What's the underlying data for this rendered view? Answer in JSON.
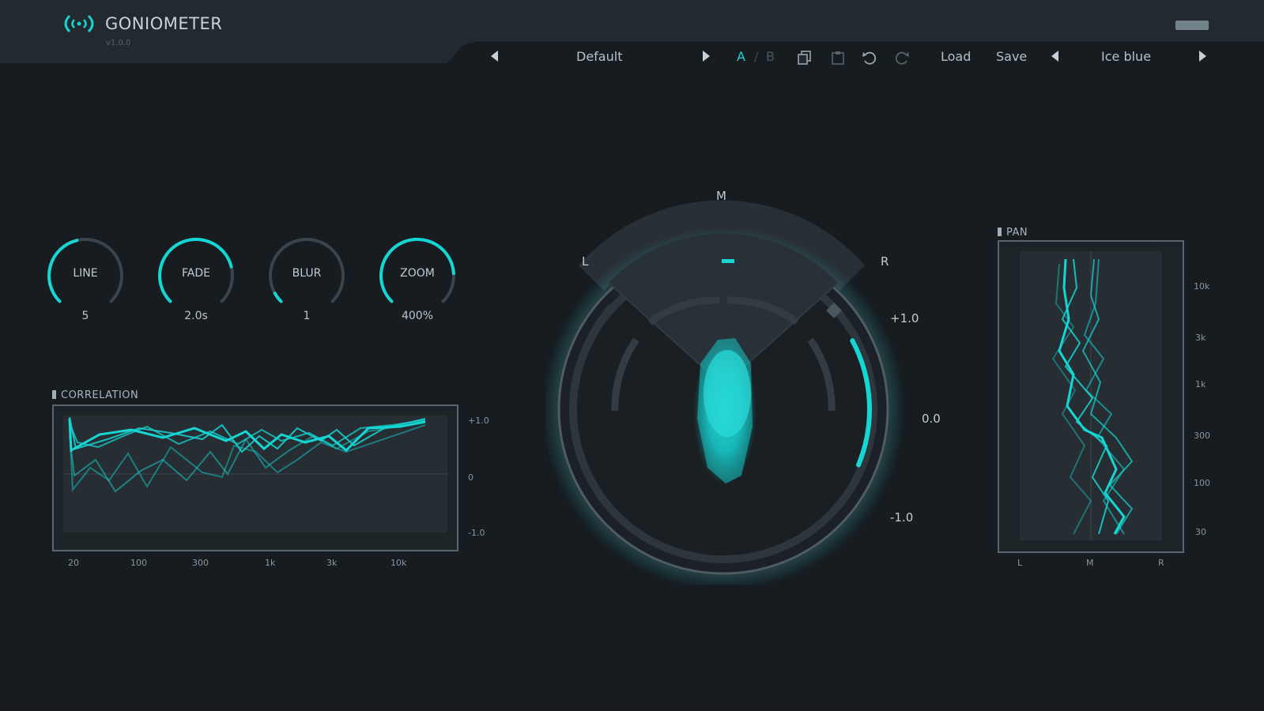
{
  "app": {
    "title": "GONIOMETER",
    "version": "v1.0.0",
    "accent": "#16d6d4"
  },
  "toolbar": {
    "preset_name": "Default",
    "ab_a": "A",
    "ab_sep": "/",
    "ab_b": "B",
    "load_label": "Load",
    "save_label": "Save",
    "theme_name": "Ice blue",
    "icons": [
      "copy-icon",
      "paste-icon",
      "undo-icon",
      "redo-icon"
    ]
  },
  "knobs": [
    {
      "name": "LINE",
      "value": "5",
      "level": 0.45
    },
    {
      "name": "FADE",
      "value": "2.0s",
      "level": 0.78
    },
    {
      "name": "BLUR",
      "value": "1",
      "level": 0.06
    },
    {
      "name": "ZOOM",
      "value": "400%",
      "level": 0.82
    }
  ],
  "correlation": {
    "label": "CORRELATION",
    "y_ticks": [
      "+1.0",
      "0",
      "-1.0"
    ],
    "x_ticks": [
      "20",
      "100",
      "300",
      "1k",
      "3k",
      "10k"
    ]
  },
  "goniometer": {
    "top_label": "M",
    "left_label": "L",
    "right_label": "R",
    "scale_labels": [
      "+1.0",
      "0.0",
      "-1.0"
    ],
    "correlation_level": 0.72
  },
  "pan": {
    "label": "PAN",
    "y_ticks": [
      "10k",
      "3k",
      "1k",
      "300",
      "100",
      "30"
    ],
    "x_ticks": [
      "L",
      "M",
      "R"
    ]
  }
}
